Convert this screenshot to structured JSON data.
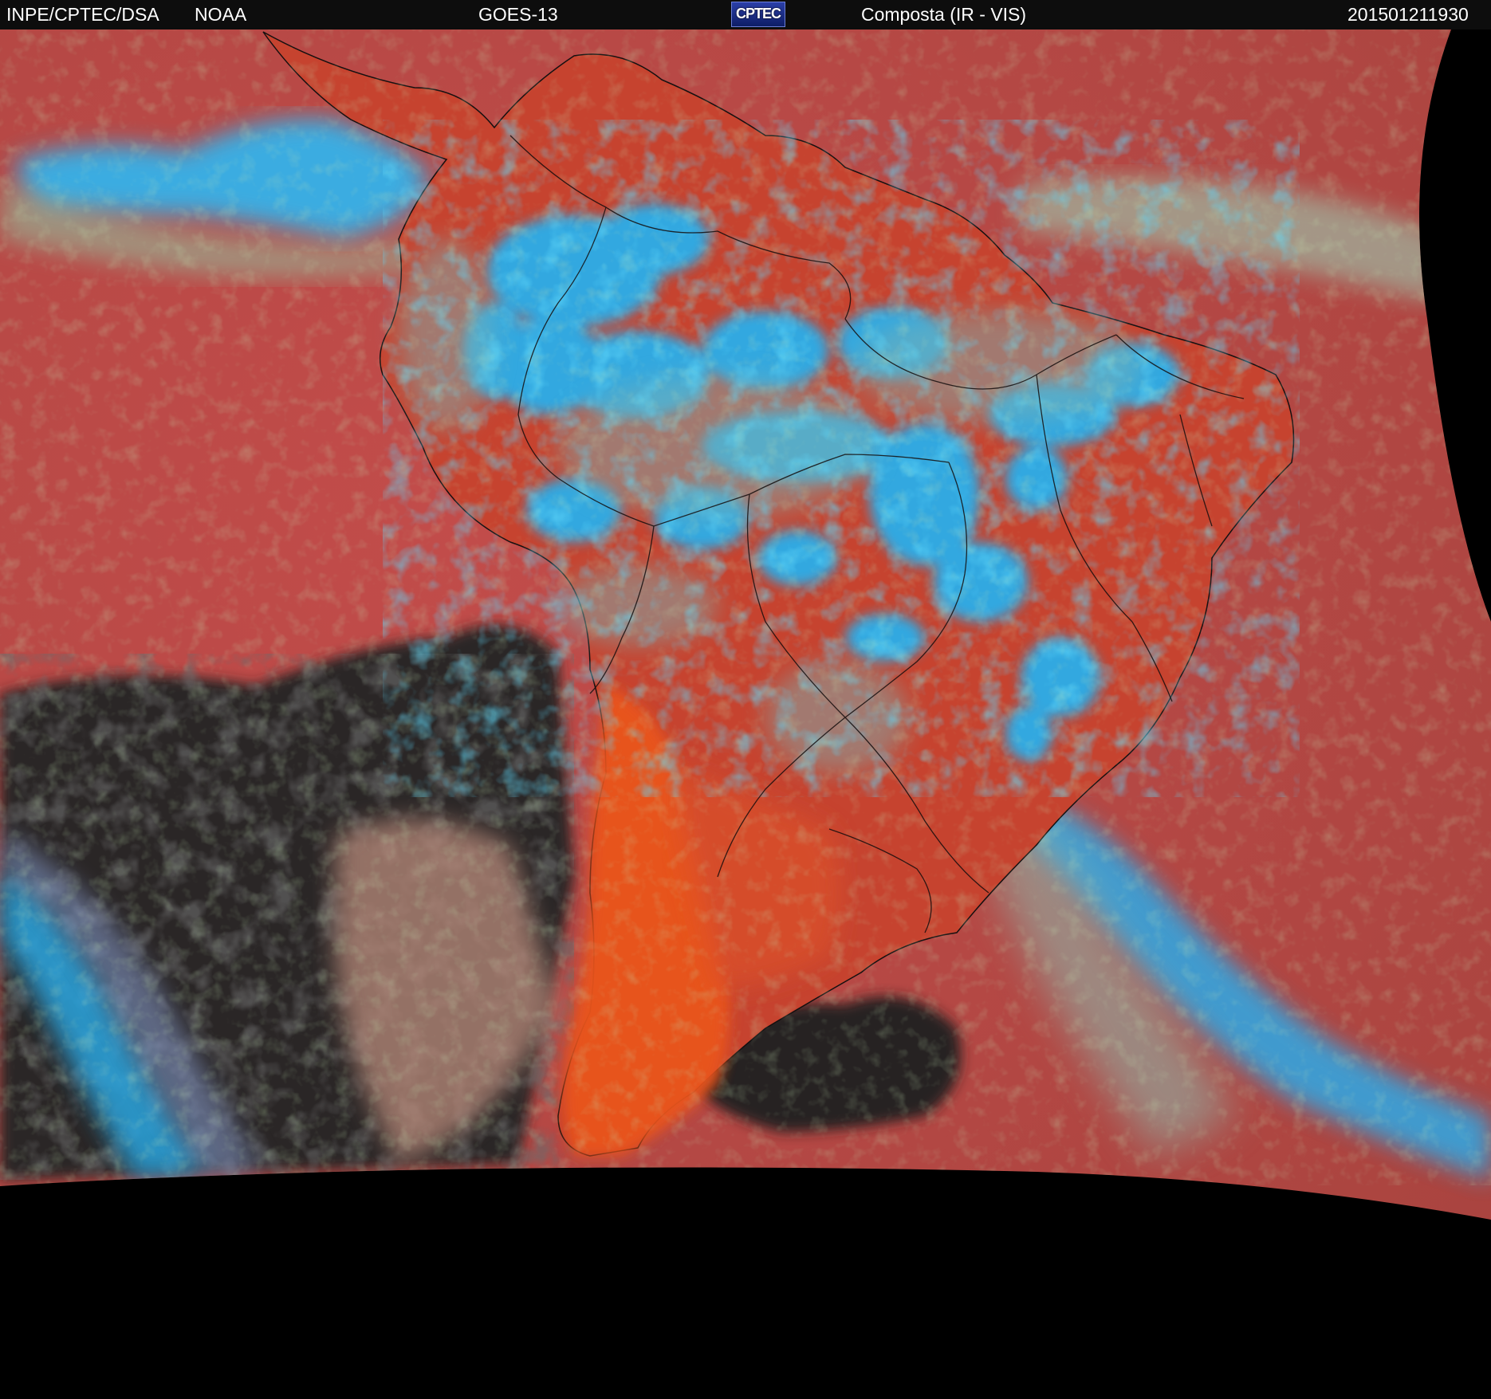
{
  "header": {
    "source": "INPE/CPTEC/DSA",
    "agency": "NOAA",
    "satellite": "GOES-13",
    "logo_text": "CPTEC",
    "product": "Composta (IR - VIS)",
    "timestamp": "201501211930"
  },
  "colors": {
    "background": "#000000",
    "header_bar": "#0d0d0d",
    "ocean_clear": "#b14a45",
    "land_clear": "#c8432f",
    "argentina_hot": "#e8521f",
    "cold_cloud": "#1fb6f5",
    "mid_cloud": "#6fb3a0",
    "dark_cloud_free": "#262626",
    "borders": "#111111"
  }
}
